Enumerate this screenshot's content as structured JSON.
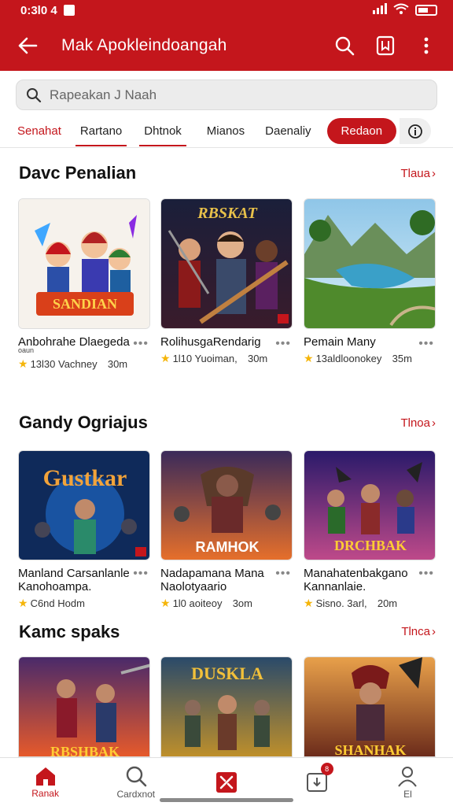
{
  "status": {
    "time": "0:3l0 4",
    "battery_icon": "battery-icon",
    "wifi_icon": "wifi-icon",
    "signal_icon": "signal-icon"
  },
  "appbar": {
    "title": "Mak Apokleindoangah",
    "icons": [
      "back-arrow-icon",
      "search-icon",
      "bookmark-icon",
      "more-vert-icon"
    ]
  },
  "search": {
    "placeholder": "Rapeakan J Naah"
  },
  "tabs": [
    {
      "label": "Senahat"
    },
    {
      "label": "Rartano"
    },
    {
      "label": "Dhtnok"
    },
    {
      "label": "Mianos"
    },
    {
      "label": "Daenaliy"
    },
    {
      "label": "Redaon"
    }
  ],
  "sections": [
    {
      "title": "Davc Penalian",
      "more": "Tlaua",
      "cards": [
        {
          "name": "Anbohrahe Dlaegeda",
          "sub": "oaun",
          "rating_text": "13l30 Vachney",
          "size": "30m"
        },
        {
          "name": "RolihusgaRendarig",
          "sub": "",
          "rating_text": "1l10 Yuoiman,",
          "size": "30m"
        },
        {
          "name": "Pemain Many",
          "sub": "",
          "rating_text": "13aldloonokey",
          "size": "35m"
        }
      ]
    },
    {
      "title": "Gandy Ogriajus",
      "more": "Tlnoa",
      "cards": [
        {
          "name": "Manland Carsanlanle Kanohoampa.",
          "sub": "",
          "rating_text": "C6nd Hodm",
          "size": ""
        },
        {
          "name": "Nadapamana Mana Naolotyaario",
          "sub": "",
          "rating_text": "1l0 aoiteoy",
          "size": "3om"
        },
        {
          "name": "Manahatenbakgano Kannanlaie.",
          "sub": "",
          "rating_text": "Sisno. 3arl,",
          "size": "20m"
        }
      ]
    },
    {
      "title": "Kamc spaks",
      "more": "Tlnca",
      "cards": []
    }
  ],
  "art_text": [
    "SANDIAN",
    "RBSKAT",
    "Gustkar",
    "RAMHOK",
    "DRCHBAK",
    "DUSKLA",
    "SHANHAK"
  ],
  "bottom_nav": [
    {
      "label": "Ranak",
      "icon": "home-icon"
    },
    {
      "label": "Cardxnot",
      "icon": "search-icon"
    },
    {
      "label": "",
      "icon": "tools-icon"
    },
    {
      "label": "",
      "icon": "downloads-icon",
      "badge": "8"
    },
    {
      "label": "El",
      "icon": "profile-icon"
    }
  ],
  "colors": {
    "brand": "#c4161c",
    "star": "#f5b50a"
  }
}
